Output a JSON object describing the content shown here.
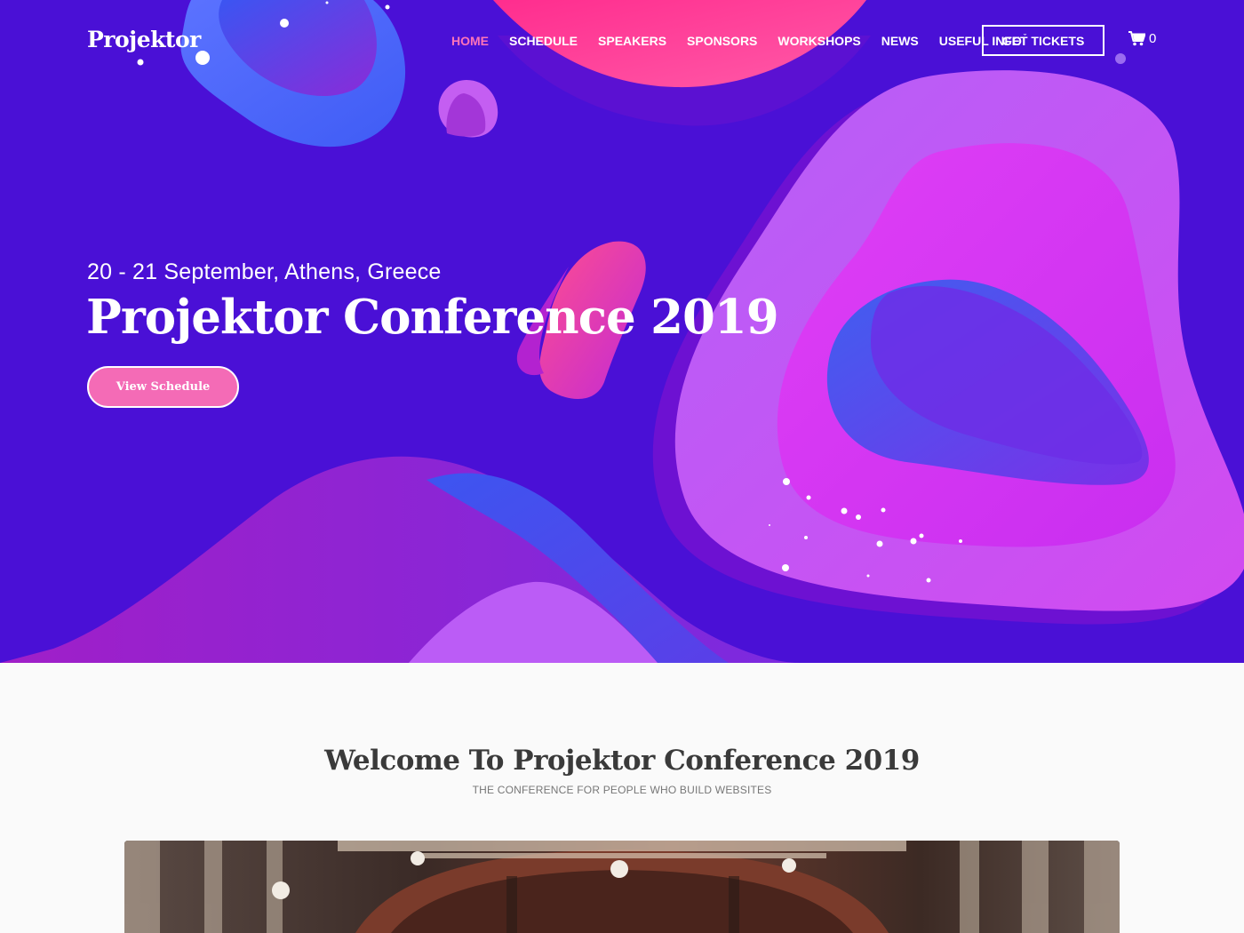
{
  "header": {
    "logo": "Projektor",
    "nav": [
      {
        "label": "HOME",
        "active": true
      },
      {
        "label": "SCHEDULE"
      },
      {
        "label": "SPEAKERS"
      },
      {
        "label": "SPONSORS"
      },
      {
        "label": "WORKSHOPS"
      },
      {
        "label": "NEWS"
      },
      {
        "label": "USEFUL INFO",
        "has_dropdown": true
      }
    ],
    "tickets_label": "GET TICKETS",
    "cart_icon": "shopping-cart-icon",
    "cart_count": "0"
  },
  "hero": {
    "date": "20 - 21 September, Athens, Greece",
    "title": "Projektor Conference 2019",
    "button_label": "View Schedule"
  },
  "welcome": {
    "title": "Welcome To Projektor Conference 2019",
    "subtitle": "THE CONFERENCE FOR PEOPLE WHO BUILD WEBSITES"
  },
  "colors": {
    "hero_bg": "#4a10d6",
    "accent_pink": "#f46bb6",
    "nav_active": "#ff74b8",
    "blob_magenta": "#d936f2",
    "blob_blue": "#4e6dff",
    "blob_violet": "#b65cf7",
    "heading_dark": "#3a3a3a"
  }
}
